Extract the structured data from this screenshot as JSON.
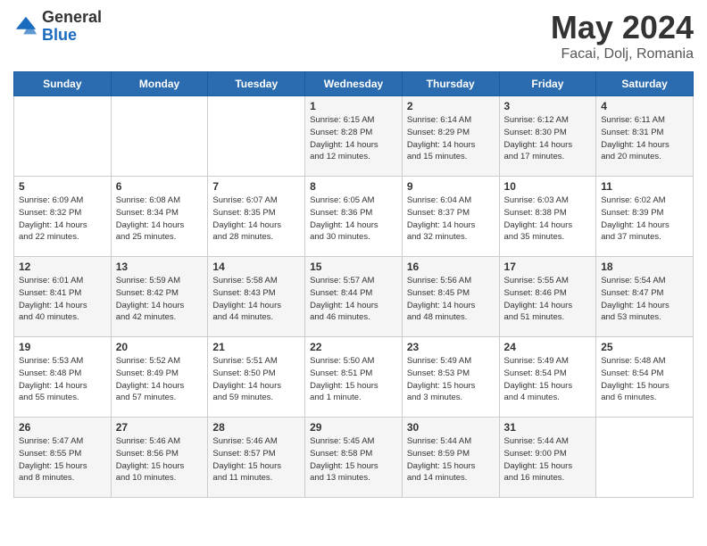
{
  "header": {
    "logo_general": "General",
    "logo_blue": "Blue",
    "title": "May 2024",
    "location": "Facai, Dolj, Romania"
  },
  "days_of_week": [
    "Sunday",
    "Monday",
    "Tuesday",
    "Wednesday",
    "Thursday",
    "Friday",
    "Saturday"
  ],
  "weeks": [
    [
      {
        "day": "",
        "info": ""
      },
      {
        "day": "",
        "info": ""
      },
      {
        "day": "",
        "info": ""
      },
      {
        "day": "1",
        "info": "Sunrise: 6:15 AM\nSunset: 8:28 PM\nDaylight: 14 hours\nand 12 minutes."
      },
      {
        "day": "2",
        "info": "Sunrise: 6:14 AM\nSunset: 8:29 PM\nDaylight: 14 hours\nand 15 minutes."
      },
      {
        "day": "3",
        "info": "Sunrise: 6:12 AM\nSunset: 8:30 PM\nDaylight: 14 hours\nand 17 minutes."
      },
      {
        "day": "4",
        "info": "Sunrise: 6:11 AM\nSunset: 8:31 PM\nDaylight: 14 hours\nand 20 minutes."
      }
    ],
    [
      {
        "day": "5",
        "info": "Sunrise: 6:09 AM\nSunset: 8:32 PM\nDaylight: 14 hours\nand 22 minutes."
      },
      {
        "day": "6",
        "info": "Sunrise: 6:08 AM\nSunset: 8:34 PM\nDaylight: 14 hours\nand 25 minutes."
      },
      {
        "day": "7",
        "info": "Sunrise: 6:07 AM\nSunset: 8:35 PM\nDaylight: 14 hours\nand 28 minutes."
      },
      {
        "day": "8",
        "info": "Sunrise: 6:05 AM\nSunset: 8:36 PM\nDaylight: 14 hours\nand 30 minutes."
      },
      {
        "day": "9",
        "info": "Sunrise: 6:04 AM\nSunset: 8:37 PM\nDaylight: 14 hours\nand 32 minutes."
      },
      {
        "day": "10",
        "info": "Sunrise: 6:03 AM\nSunset: 8:38 PM\nDaylight: 14 hours\nand 35 minutes."
      },
      {
        "day": "11",
        "info": "Sunrise: 6:02 AM\nSunset: 8:39 PM\nDaylight: 14 hours\nand 37 minutes."
      }
    ],
    [
      {
        "day": "12",
        "info": "Sunrise: 6:01 AM\nSunset: 8:41 PM\nDaylight: 14 hours\nand 40 minutes."
      },
      {
        "day": "13",
        "info": "Sunrise: 5:59 AM\nSunset: 8:42 PM\nDaylight: 14 hours\nand 42 minutes."
      },
      {
        "day": "14",
        "info": "Sunrise: 5:58 AM\nSunset: 8:43 PM\nDaylight: 14 hours\nand 44 minutes."
      },
      {
        "day": "15",
        "info": "Sunrise: 5:57 AM\nSunset: 8:44 PM\nDaylight: 14 hours\nand 46 minutes."
      },
      {
        "day": "16",
        "info": "Sunrise: 5:56 AM\nSunset: 8:45 PM\nDaylight: 14 hours\nand 48 minutes."
      },
      {
        "day": "17",
        "info": "Sunrise: 5:55 AM\nSunset: 8:46 PM\nDaylight: 14 hours\nand 51 minutes."
      },
      {
        "day": "18",
        "info": "Sunrise: 5:54 AM\nSunset: 8:47 PM\nDaylight: 14 hours\nand 53 minutes."
      }
    ],
    [
      {
        "day": "19",
        "info": "Sunrise: 5:53 AM\nSunset: 8:48 PM\nDaylight: 14 hours\nand 55 minutes."
      },
      {
        "day": "20",
        "info": "Sunrise: 5:52 AM\nSunset: 8:49 PM\nDaylight: 14 hours\nand 57 minutes."
      },
      {
        "day": "21",
        "info": "Sunrise: 5:51 AM\nSunset: 8:50 PM\nDaylight: 14 hours\nand 59 minutes."
      },
      {
        "day": "22",
        "info": "Sunrise: 5:50 AM\nSunset: 8:51 PM\nDaylight: 15 hours\nand 1 minute."
      },
      {
        "day": "23",
        "info": "Sunrise: 5:49 AM\nSunset: 8:53 PM\nDaylight: 15 hours\nand 3 minutes."
      },
      {
        "day": "24",
        "info": "Sunrise: 5:49 AM\nSunset: 8:54 PM\nDaylight: 15 hours\nand 4 minutes."
      },
      {
        "day": "25",
        "info": "Sunrise: 5:48 AM\nSunset: 8:54 PM\nDaylight: 15 hours\nand 6 minutes."
      }
    ],
    [
      {
        "day": "26",
        "info": "Sunrise: 5:47 AM\nSunset: 8:55 PM\nDaylight: 15 hours\nand 8 minutes."
      },
      {
        "day": "27",
        "info": "Sunrise: 5:46 AM\nSunset: 8:56 PM\nDaylight: 15 hours\nand 10 minutes."
      },
      {
        "day": "28",
        "info": "Sunrise: 5:46 AM\nSunset: 8:57 PM\nDaylight: 15 hours\nand 11 minutes."
      },
      {
        "day": "29",
        "info": "Sunrise: 5:45 AM\nSunset: 8:58 PM\nDaylight: 15 hours\nand 13 minutes."
      },
      {
        "day": "30",
        "info": "Sunrise: 5:44 AM\nSunset: 8:59 PM\nDaylight: 15 hours\nand 14 minutes."
      },
      {
        "day": "31",
        "info": "Sunrise: 5:44 AM\nSunset: 9:00 PM\nDaylight: 15 hours\nand 16 minutes."
      },
      {
        "day": "",
        "info": ""
      }
    ]
  ]
}
